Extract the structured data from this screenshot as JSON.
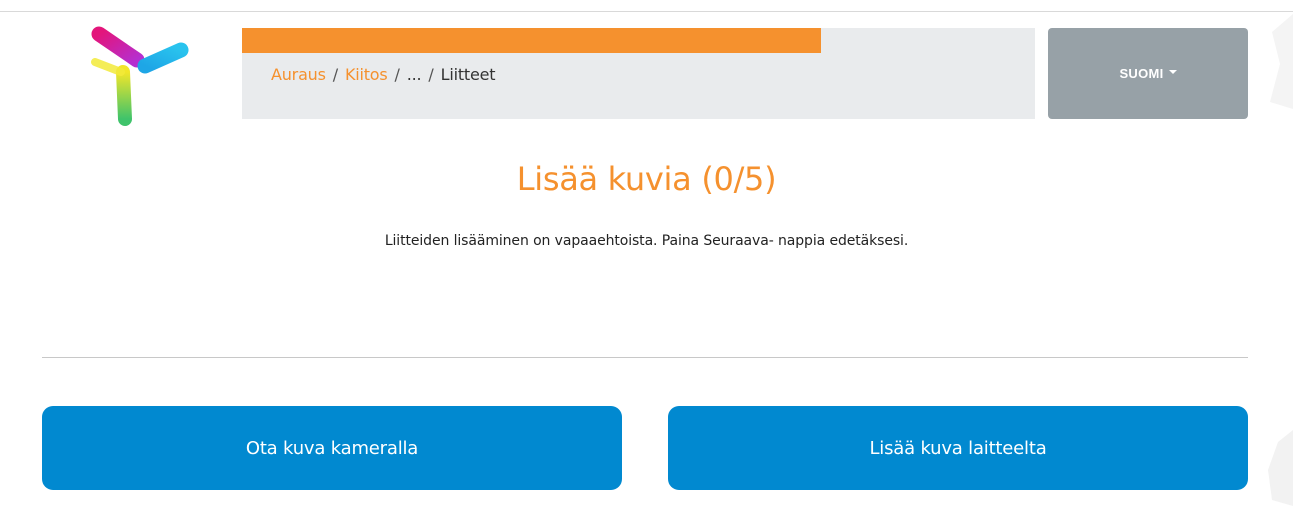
{
  "header": {
    "progress_fraction": 0.73,
    "breadcrumb": [
      {
        "label": "Auraus",
        "link": true
      },
      {
        "label": "Kiitos",
        "link": true
      },
      {
        "label": "...",
        "link": false
      },
      {
        "label": "Liitteet",
        "link": false
      }
    ],
    "separator": "/",
    "language_label": "SUOMI"
  },
  "main": {
    "title": "Lisää kuvia (0/5)",
    "description": "Liitteiden lisääminen on vapaaehtoista. Paina Seuraava- nappia edetäksesi.",
    "camera_button": "Ota kuva kameralla",
    "device_button": "Lisää kuva laitteelta"
  },
  "colors": {
    "accent": "#f5912e",
    "button": "#0189d0",
    "language_button": "#97a1a7",
    "breadcrumb_bg": "#e9ebed"
  }
}
